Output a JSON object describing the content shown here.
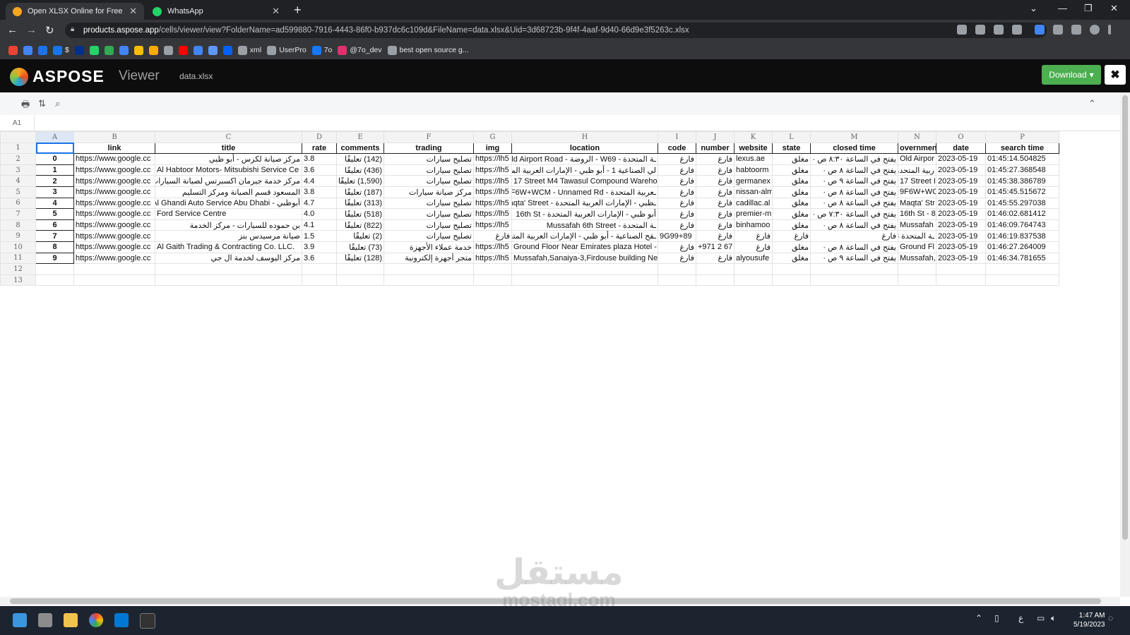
{
  "browser": {
    "tabs": [
      {
        "title": "Open XLSX Online for Free",
        "active": true,
        "favicon_color": "#f5a623"
      },
      {
        "title": "WhatsApp",
        "active": false,
        "favicon_color": "#25d366"
      }
    ],
    "url_host": "products.aspose.app",
    "url_rest": "/cells/viewer/view?FolderName=ad599880-7916-4443-86f0-b937dc6c109d&FileName=data.xlsx&Uid=3d68723b-9f4f-4aaf-9d40-66d9e3f5263c.xlsx",
    "bookmarks": [
      {
        "label": "",
        "color": "#ea4335"
      },
      {
        "label": "",
        "color": "#4285f4"
      },
      {
        "label": "",
        "color": "#1a73e8"
      },
      {
        "label": "$",
        "color": "#1a73e8"
      },
      {
        "label": "",
        "color": "#003087"
      },
      {
        "label": "",
        "color": "#25d366"
      },
      {
        "label": "",
        "color": "#34a853"
      },
      {
        "label": "",
        "color": "#4285f4"
      },
      {
        "label": "",
        "color": "#fbbc04"
      },
      {
        "label": "",
        "color": "#f9ab00"
      },
      {
        "label": "",
        "color": "#9aa0a6"
      },
      {
        "label": "",
        "color": "#ff0000"
      },
      {
        "label": "",
        "color": "#4285f4"
      },
      {
        "label": "",
        "color": "#5e97f6"
      },
      {
        "label": "",
        "color": "#0061ff"
      },
      {
        "label": "xml",
        "color": "#9aa0a6"
      },
      {
        "label": "UserPro",
        "color": "#9aa0a6"
      },
      {
        "label": "7o",
        "color": "#1877f2"
      },
      {
        "label": "@7o_dev",
        "color": "#e1306c"
      },
      {
        "label": "best open source g...",
        "color": "#9aa0a6"
      }
    ]
  },
  "app": {
    "logo_text": "ASPOSE",
    "viewer_label": "Viewer",
    "file_name": "data.xlsx",
    "download_label": "Download",
    "cell_ref": "A1"
  },
  "sheet": {
    "column_letters": [
      "A",
      "B",
      "C",
      "D",
      "E",
      "F",
      "G",
      "H",
      "I",
      "J",
      "K",
      "L",
      "M",
      "N",
      "O",
      "P"
    ],
    "header_row": [
      "",
      "link",
      "title",
      "rate",
      "comments",
      "trading",
      "img",
      "location",
      "code",
      "number",
      "website",
      "state",
      "closed time",
      "overnmen",
      "date",
      "search time"
    ],
    "rows": [
      [
        "0",
        "https://www.google.cc",
        "مركز صيانة لكزس - أبو ظبي",
        "3.8",
        "(142) تعليقًا",
        "تصليح سيارات",
        "https://lh5",
        "ـة المتحدة - W69 - الروضة - Old Airport Road",
        "فارغ",
        "فارغ",
        "lexus.ae",
        "مغلق",
        "يفتح في الساعة ٨:٣٠ ص ·",
        "Old Airpor",
        "2023-05-19",
        "01:45:14.504825"
      ],
      [
        "1",
        "https://www.google.cc",
        "Al Habtoor Motors- Mitsubishi Service Ce",
        "3.6",
        "(436) تعليقًا",
        "تصليح سيارات",
        "https://lh5",
        "لي الصناعية 1 - أبو ظبي - الإمارات العربية المتحدة",
        "فارغ",
        "فارغ",
        "habtoorm",
        "مغلق",
        "يفتح في الساعة ٨ ص ·",
        "ربية المتحدة",
        "2023-05-19",
        "01:45:27.368548"
      ],
      [
        "2",
        "https://www.google.cc",
        "مركز خدمة جيرمان اكسبرتس لصيانة السيارات",
        "4.4",
        "(1,590) تعليقًا",
        "تصليح سيارات",
        "https://lh5",
        "17 Street M4 Tawasul Compound Wareho",
        "فارغ",
        "فارغ",
        "germanex",
        "مغلق",
        "يفتح في الساعة ٩ ص ·",
        "17 Street I",
        "2023-05-19",
        "01:45:38.386789"
      ],
      [
        "3",
        "https://www.google.cc",
        "المسعود قسم الصيانة ومركز التسليم",
        "3.8",
        "(187) تعليقًا",
        "مركز صيانة سيارات",
        "https://lh5",
        "ـعربية المتحدة - 9F6W+WCM - Unnamed Rd",
        "فارغ",
        "فارغ",
        "nissan-alm",
        "مغلق",
        "يفتح في الساعة ٨ ص ·",
        "9F6W+WC",
        "2023-05-19",
        "01:45:45.515672"
      ],
      [
        "4",
        "https://www.google.cc",
        "أبوظبي - Al Ghandi Auto Service Abu Dhabi",
        "4.7",
        "(313) تعليقًا",
        "تصليح سيارات",
        "https://lh5",
        "ـظبي - الإمارات العربية المتحدة - Maqta' Street",
        "فارغ",
        "فارغ",
        "cadillac.al",
        "مغلق",
        "يفتح في الساعة ٨ ص ·",
        "Maqta' Str",
        "2023-05-19",
        "01:45:55.297038"
      ],
      [
        "5",
        "https://www.google.cc",
        "Ford Service Centre",
        "4.0",
        "(518) تعليقًا",
        "تصليح سيارات",
        "https://lh5",
        "أبو ظبي - الإمارات العربية المتحدة - 16th St",
        "فارغ",
        "فارغ",
        "premier-m",
        "مغلق",
        "يفتح في الساعة ٧:٣٠ ص ·",
        "16th St - 8",
        "2023-05-19",
        "01:46:02.681412"
      ],
      [
        "6",
        "https://www.google.cc",
        "بن حموده للسيارات - مركز الخدمة",
        "4.1",
        "(822) تعليقًا",
        "تصليح سيارات",
        "https://lh5",
        "ـة المتحدة - Mussafah 6th Street",
        "فارغ",
        "فارغ",
        "binhamoo",
        "مغلق",
        "يفتح في الساعة ٨ ص ·",
        "Mussafah",
        "2023-05-19",
        "01:46:09.764743"
      ],
      [
        "7",
        "https://www.google.cc",
        "صيانة مرسيدس بنز",
        "1.5",
        "(2) تعليقًا",
        "تصليح سيارات",
        "فارغ",
        "ـقح الصناعية - أبو ظبي - الإمارات العربية المتحدة 8",
        "9G99+89",
        "فارغ",
        "فارغ",
        "فارغ",
        "فارغ",
        "ـة المتحدة 8",
        "2023-05-19",
        "01:46:19.837538"
      ],
      [
        "8",
        "https://www.google.cc",
        "Al Gaith Trading & Contracting Co. LLC.",
        "3.9",
        "(73) تعليقًا",
        "خدمة عملاء الأجهزة",
        "https://lh5",
        "Ground Floor Near Emirates plaza Hotel -",
        "فارغ",
        "+971 2 67",
        "فارغ",
        "مغلق",
        "يفتح في الساعة ٨ ص ·",
        "Ground Fl",
        "2023-05-19",
        "01:46:27.264009"
      ],
      [
        "9",
        "https://www.google.cc",
        "مركز اليوسف لخدمة ال جي",
        "3.6",
        "(128) تعليقًا",
        "متجر أجهزة إلكترونية",
        "https://lh5",
        "Mussafah,Sanaiya-3,Firdouse building Ne",
        "فارغ",
        "فارغ",
        "alyousufe",
        "مغلق",
        "يفتح في الساعة ٩ ص ·",
        "Mussafah,",
        "2023-05-19",
        "01:46:34.781655"
      ]
    ],
    "row_numbers": [
      "1",
      "2",
      "3",
      "4",
      "5",
      "6",
      "7",
      "8",
      "9",
      "10",
      "11",
      "12",
      "13"
    ]
  },
  "watermark": {
    "arabic": "مستقل",
    "latin": "mostaql.com"
  },
  "taskbar": {
    "time": "1:47 AM",
    "date": "5/19/2023",
    "lang": "ع"
  }
}
